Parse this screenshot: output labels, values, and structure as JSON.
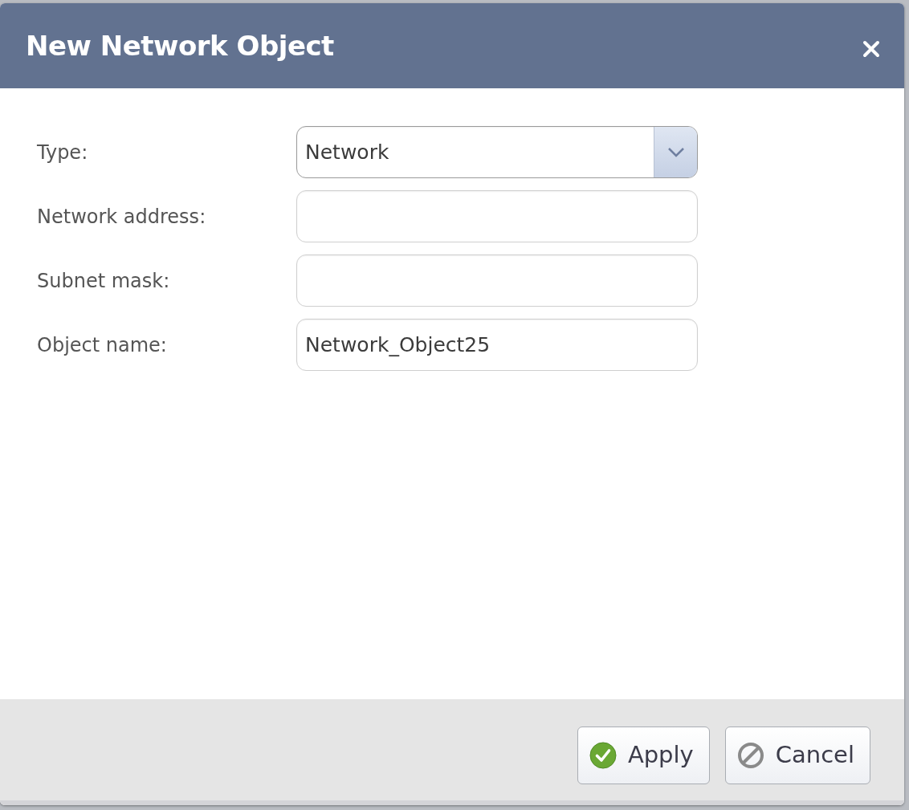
{
  "dialog": {
    "title": "New Network Object"
  },
  "fields": [
    {
      "label": "Type:",
      "kind": "select",
      "value": "Network"
    },
    {
      "label": "Network address:",
      "kind": "text"
    },
    {
      "label": "Subnet mask:",
      "kind": "text"
    },
    {
      "label": "Object name:",
      "kind": "text",
      "value": "Network_Object25"
    }
  ],
  "buttons": [
    {
      "label": "Apply",
      "kind": "apply"
    },
    {
      "label": "Cancel",
      "kind": "cancel"
    }
  ]
}
